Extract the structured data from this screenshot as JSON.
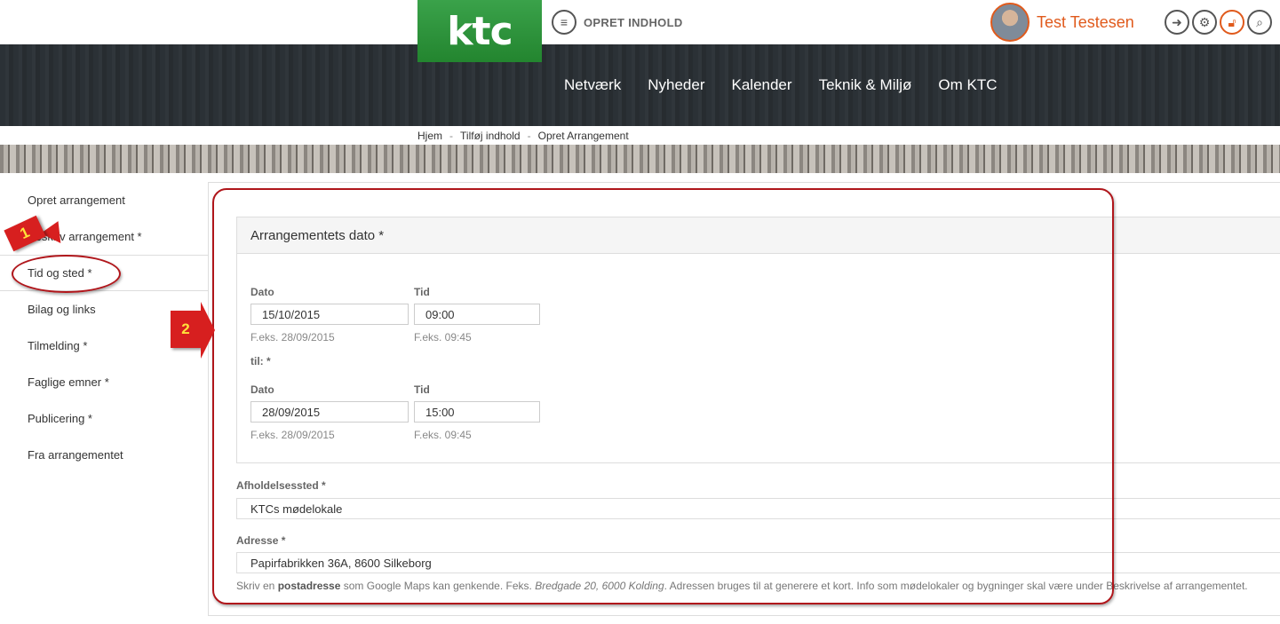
{
  "header": {
    "logo_text": "ktc",
    "create_label": "OPRET INDHOLD",
    "user_name": "Test Testesen",
    "tool_icons": [
      "download-icon",
      "gear-icon",
      "lock-icon",
      "search-icon"
    ]
  },
  "nav": {
    "items": [
      "Netværk",
      "Nyheder",
      "Kalender",
      "Teknik & Miljø",
      "Om KTC"
    ]
  },
  "breadcrumb": [
    "Hjem",
    "Tilføj indhold",
    "Opret Arrangement"
  ],
  "breadcrumb_sep": "-",
  "sidebar": {
    "items": [
      {
        "label": "Opret arrangement"
      },
      {
        "label": "Beskriv arrangement *"
      },
      {
        "label": "Tid og sted *"
      },
      {
        "label": "Bilag og links"
      },
      {
        "label": "Tilmelding *"
      },
      {
        "label": "Faglige emner *"
      },
      {
        "label": "Publicering *"
      },
      {
        "label": "Fra arrangementet"
      }
    ],
    "active_index": 2
  },
  "form": {
    "panel_title": "Arrangementets dato *",
    "start": {
      "date_label": "Dato",
      "time_label": "Tid",
      "date_value": "15/10/2015",
      "time_value": "09:00",
      "date_hint": "F.eks. 28/09/2015",
      "time_hint": "F.eks. 09:45"
    },
    "til_label": "til: *",
    "end": {
      "date_label": "Dato",
      "time_label": "Tid",
      "date_value": "28/09/2015",
      "time_value": "15:00",
      "date_hint": "F.eks. 28/09/2015",
      "time_hint": "F.eks. 09:45"
    },
    "venue_label": "Afholdelsessted *",
    "venue_value": "KTCs mødelokale",
    "address_label": "Adresse *",
    "address_value": "Papirfabrikken 36A, 8600 Silkeborg",
    "help": {
      "part1": "Skriv en ",
      "bold": "postadresse",
      "part2": " som Google Maps kan genkende. Feks. ",
      "italic": "Bredgade 20, 6000 Kolding",
      "part3": ". Adressen bruges til at generere et kort. Info som mødelokaler og bygninger skal være under Beskrivelse af arrangementet."
    }
  },
  "annotations": {
    "marker_1": "1",
    "marker_2": "2"
  },
  "colors": {
    "accent_orange": "#e05a1c",
    "logo_green": "#2e9a3e",
    "annotation_red": "#b0161b"
  }
}
